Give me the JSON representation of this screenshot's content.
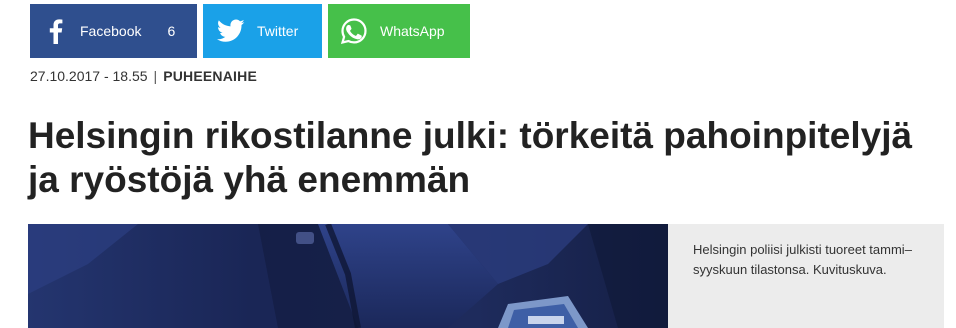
{
  "share": {
    "facebook": {
      "label": "Facebook",
      "count": "6",
      "icon": "facebook-icon",
      "color": "#2f4f8e"
    },
    "twitter": {
      "label": "Twitter",
      "icon": "twitter-icon",
      "color": "#1aa1e8"
    },
    "whatsapp": {
      "label": "WhatsApp",
      "icon": "whatsapp-icon",
      "color": "#46c04a"
    }
  },
  "meta": {
    "datetime": "27.10.2017 - 18.55",
    "separator": "|",
    "category": "PUHEENAIHE"
  },
  "article": {
    "headline": "Helsingin rikostilanne julki: törkeitä pahoinpitelyjä ja ryöstöjä yhä enemmän",
    "caption": "Helsingin poliisi julkisti tuoreet tammi–syyskuun tilastonsa. Kuvituskuva."
  }
}
